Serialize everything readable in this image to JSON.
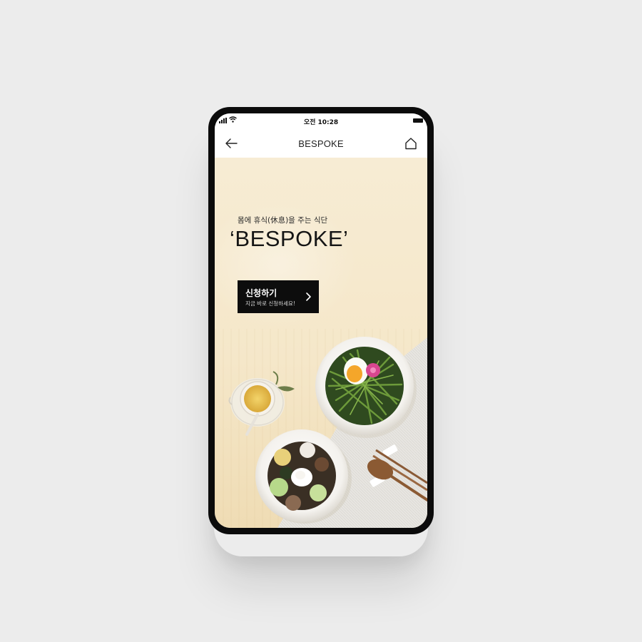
{
  "status_bar": {
    "time": "오전 10:28"
  },
  "nav": {
    "title": "BESPOKE",
    "back_icon": "arrow-left-icon",
    "home_icon": "home-icon"
  },
  "hero": {
    "subtitle": "몸에 휴식(休息)을 주는 식단",
    "headline": "‘BESPOKE’",
    "cta": {
      "title": "신청하기",
      "subtitle": "지금 바로 신청하세요!",
      "icon": "chevron-right-icon"
    }
  },
  "colors": {
    "hero_background": "#f6e9cc",
    "cta_background": "#0d0d0d",
    "page_background": "#ececec"
  }
}
